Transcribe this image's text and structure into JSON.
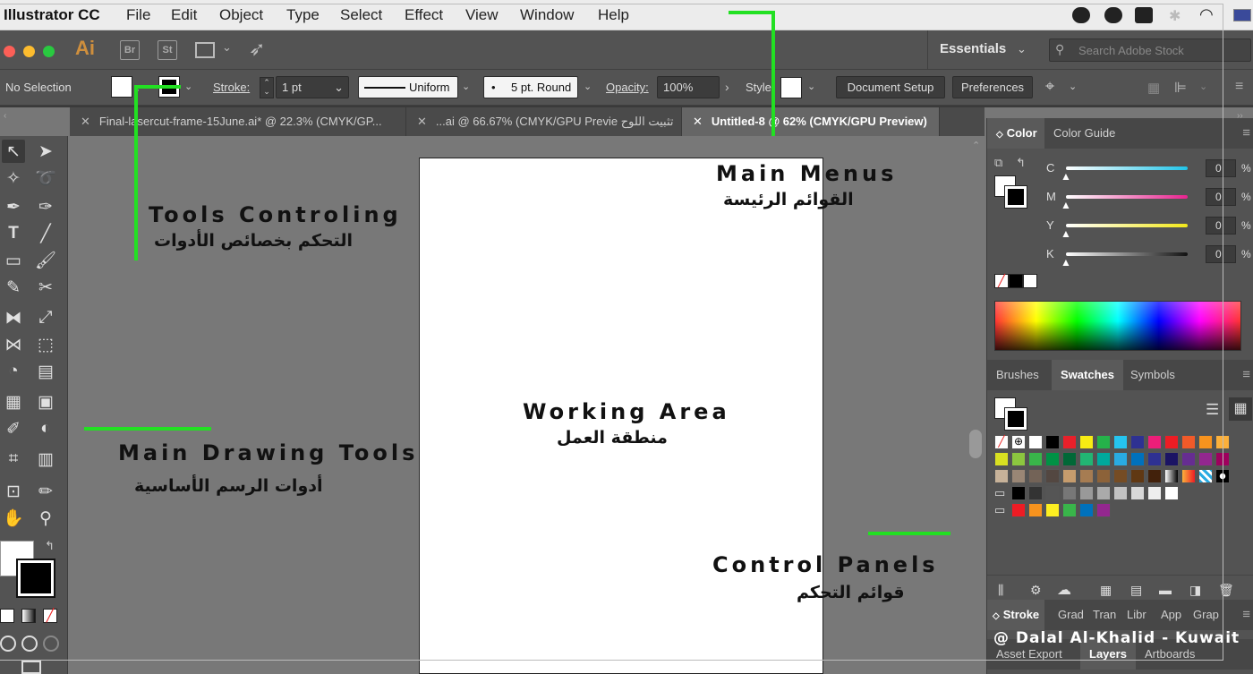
{
  "menubar": {
    "app_name": "Illustrator CC",
    "items": [
      "File",
      "Edit",
      "Object",
      "Type",
      "Select",
      "Effect",
      "View",
      "Window",
      "Help"
    ]
  },
  "appbar": {
    "logo": "Ai",
    "bridge": "Br",
    "stock": "St",
    "workspace": "Essentials",
    "search_placeholder": "Search Adobe Stock"
  },
  "control": {
    "selection": "No Selection",
    "stroke_label": "Stroke:",
    "stroke_value": "1 pt",
    "profile": "Uniform",
    "brush": "5 pt. Round",
    "opacity_label": "Opacity:",
    "opacity_value": "100%",
    "style_label": "Style",
    "document_setup": "Document Setup",
    "preferences": "Preferences"
  },
  "tabs": [
    {
      "label": "Final-lasercut-frame-15June.ai* @ 22.3% (CMYK/GP..."
    },
    {
      "label": "...ai @ 66.67% (CMYK/GPU Previe تثبيت اللوح"
    },
    {
      "label": "Untitled-8 @ 62% (CMYK/GPU Preview)"
    }
  ],
  "panels": {
    "color_tab": "Color",
    "color_guide_tab": "Color Guide",
    "channels": [
      {
        "label": "C",
        "value": "0",
        "unit": "%",
        "color": "#21c4e8"
      },
      {
        "label": "M",
        "value": "0",
        "unit": "%",
        "color": "#e8238f"
      },
      {
        "label": "Y",
        "value": "0",
        "unit": "%",
        "color": "#f2e81a"
      },
      {
        "label": "K",
        "value": "0",
        "unit": "%",
        "color": "#111111"
      }
    ],
    "library_tabs": [
      "Brushes",
      "Swatches",
      "Symbols"
    ],
    "active_library_tab": "Swatches",
    "bottom_tabs": [
      "Stroke",
      "Grad",
      "Tran",
      "Libr",
      "App",
      "Grap"
    ],
    "bottom_tabs2": [
      "Asset Export",
      "Layers",
      "Artboards"
    ]
  },
  "annotations": {
    "main_menus_en": "Main Menus",
    "main_menus_ar": "القوائم الرئيسة",
    "tools_controling_en": "Tools Controling",
    "tools_controling_ar": "التحكم بخصائص الأدوات",
    "working_area_en": "Working Area",
    "working_area_ar": "منطقة العمل",
    "main_drawing_en": "Main Drawing Tools",
    "main_drawing_ar": "أدوات الرسم الأساسية",
    "control_panels_en": "Control Panels",
    "control_panels_ar": "قوائم التحكم",
    "credit": "@ Dalal Al-Khalid - Kuwait"
  },
  "colors": {
    "annotation_line": "#22e022",
    "ui_dark": "#535353",
    "canvas": "#787878"
  }
}
